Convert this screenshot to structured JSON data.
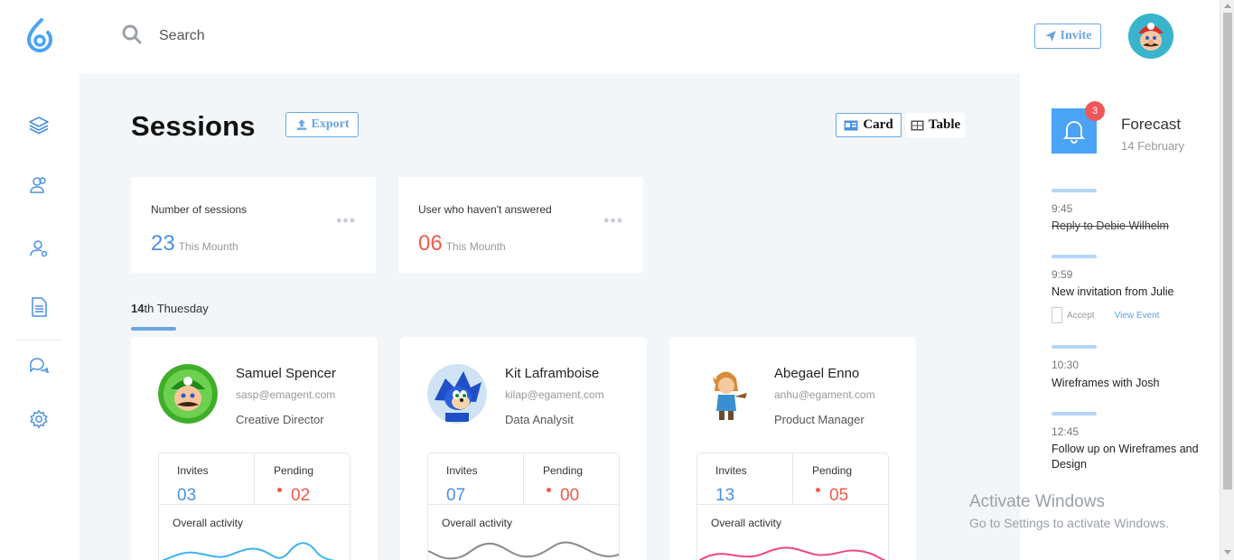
{
  "topbar": {
    "search_placeholder": "Search",
    "invite_label": "Invite"
  },
  "nav": {
    "items": [
      "layers-icon",
      "users-icon",
      "user-settings-icon",
      "document-icon",
      "chat-icon",
      "gear-icon"
    ]
  },
  "main": {
    "title": "Sessions",
    "export_label": "Export",
    "view_card_label": "Card",
    "view_table_label": "Table",
    "stats": [
      {
        "label": "Number of sessions",
        "value": "23",
        "sub": "This Mounth",
        "color": "#4a90e2"
      },
      {
        "label": "User who haven't answered",
        "value": "06",
        "sub": "This Mounth",
        "color": "#ef5a4a"
      }
    ],
    "date_day": "14",
    "date_rest": "th Thuesday",
    "people": [
      {
        "name": "Samuel Spencer",
        "email": "sasp@emagent.com",
        "role": "Creative Director",
        "invites_label": "Invites",
        "invites": "03",
        "pending_label": "Pending",
        "pending": "02",
        "activity_label": "Overall activity",
        "activity_color": "#3ab5f0"
      },
      {
        "name": "Kit Laframboise",
        "email": "kilap@egament.com",
        "role": "Data Analysit",
        "invites_label": "Invites",
        "invites": "07",
        "pending_label": "Pending",
        "pending": "00",
        "activity_label": "Overall activity",
        "activity_color": "#8a8a8a"
      },
      {
        "name": "Abegael Enno",
        "email": "anhu@egament.com",
        "role": "Product Manager",
        "invites_label": "Invites",
        "invites": "13",
        "pending_label": "Pending",
        "pending": "05",
        "activity_label": "Overall activity",
        "activity_color": "#f0487a"
      }
    ]
  },
  "forecast": {
    "badge": "3",
    "title": "Forecast",
    "date": "14 February",
    "events": [
      {
        "time": "9:45",
        "title": "Reply to Debie Wilhelm",
        "done": true
      },
      {
        "time": "9:59",
        "title": "New invitation from Julie",
        "accept_label": "Accept",
        "view_label": "View Event"
      },
      {
        "time": "10:30",
        "title": "Wireframes with Josh"
      },
      {
        "time": "12:45",
        "title": "Follow up on Wireframes and Design"
      }
    ]
  },
  "watermark": {
    "title": "Activate Windows",
    "subtitle": "Go to Settings to activate Windows."
  },
  "colors": {
    "accent": "#4a90e2",
    "danger": "#ef5a4a",
    "bell": "#4aa3f5"
  }
}
